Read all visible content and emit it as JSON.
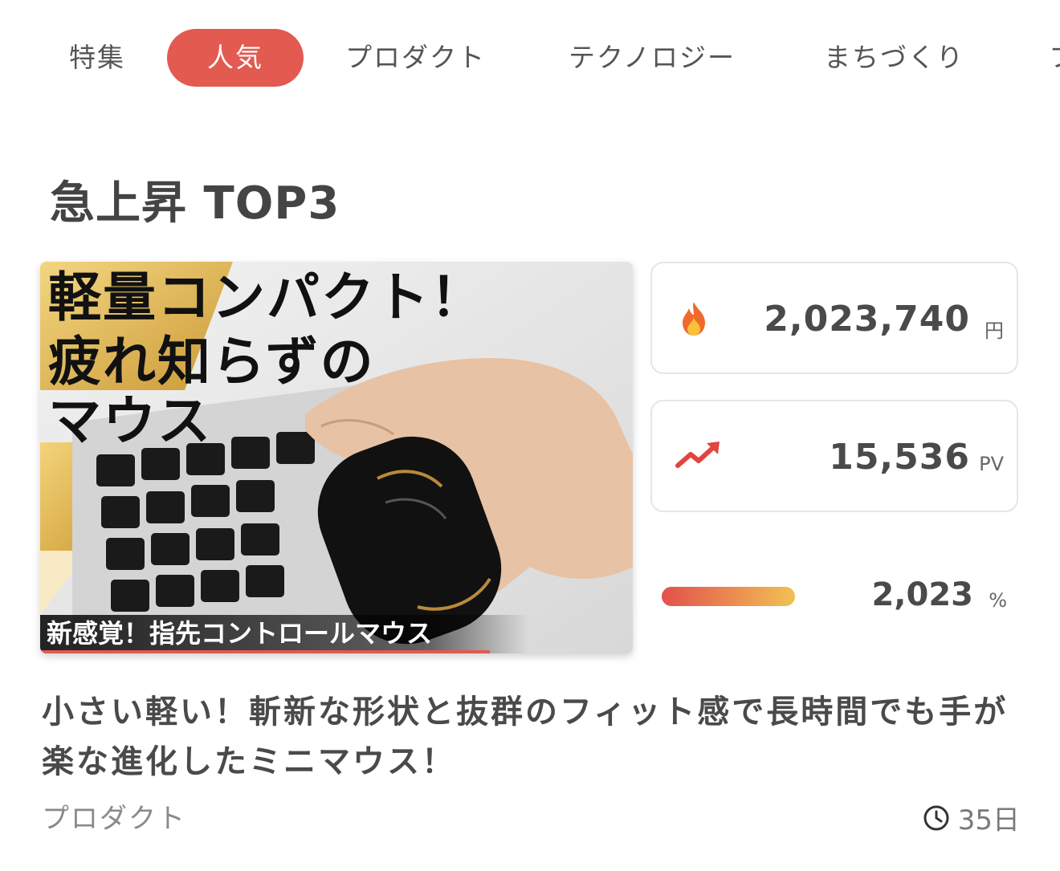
{
  "tabs": [
    {
      "label": "特集",
      "active": false
    },
    {
      "label": "人気",
      "active": true
    },
    {
      "label": "プロダクト",
      "active": false
    },
    {
      "label": "テクノロジー",
      "active": false
    },
    {
      "label": "まちづくり",
      "active": false
    },
    {
      "label": "フ",
      "active": false
    }
  ],
  "section": {
    "title": "急上昇 TOP3"
  },
  "card": {
    "thumbnail": {
      "headline_line1": "軽量コンパクト！",
      "headline_line2": "疲れ知らずの",
      "headline_line3": "マウス",
      "caption": "新感覚！指先コントロールマウス"
    },
    "stats": {
      "sales": {
        "icon": "fire-icon",
        "value": "2,023,740",
        "unit": "円"
      },
      "views": {
        "icon": "trending-up-icon",
        "value": "15,536",
        "unit": "PV"
      },
      "growth": {
        "value": "2,023",
        "unit": "%"
      }
    },
    "title": "小さい軽い！斬新な形状と抜群のフィット感で長時間でも手が楽な進化したミニマウス！",
    "category": "プロダクト",
    "time_ago": "35日"
  },
  "colors": {
    "accent": "#e25a50",
    "gradient_start": "#e3504c",
    "gradient_end": "#f1c154"
  }
}
